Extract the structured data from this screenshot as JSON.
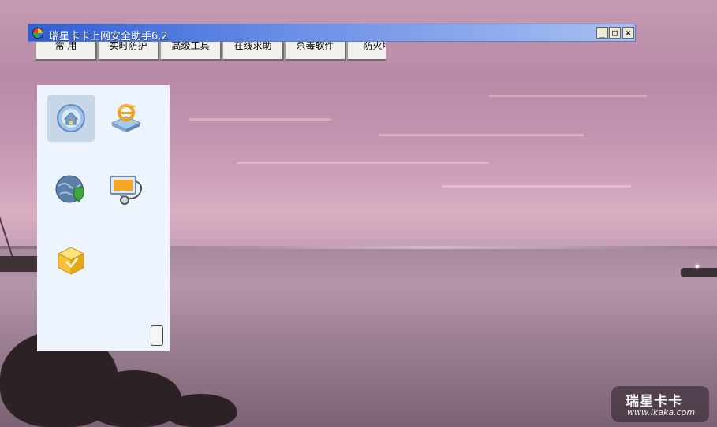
{
  "window": {
    "title": "瑞星卡卡上网安全助手6.2",
    "controls": {
      "minimize": "_",
      "maximize": "□",
      "close": "×"
    }
  },
  "tabs": [
    {
      "label": "常 用"
    },
    {
      "label": "实时防护"
    },
    {
      "label": "高级工具"
    },
    {
      "label": "在线求助"
    },
    {
      "label": "杀毒软件"
    },
    {
      "label": "防火墙"
    }
  ],
  "panel": {
    "tools": [
      {
        "icon": "home-shield-icon",
        "selected": true
      },
      {
        "icon": "ie-repair-icon",
        "selected": false
      },
      {
        "icon": "globe-shield-icon",
        "selected": false
      },
      {
        "icon": "system-diagnosis-icon",
        "selected": false
      },
      {
        "icon": "gold-box-icon",
        "selected": false
      }
    ]
  },
  "watermark": {
    "title": "瑞星卡卡",
    "url": "www.ikaka.com"
  },
  "colors": {
    "titlebar_start": "#2f5fd6",
    "titlebar_end": "#a9c0f2",
    "panel_bg": "#eef4fd"
  }
}
